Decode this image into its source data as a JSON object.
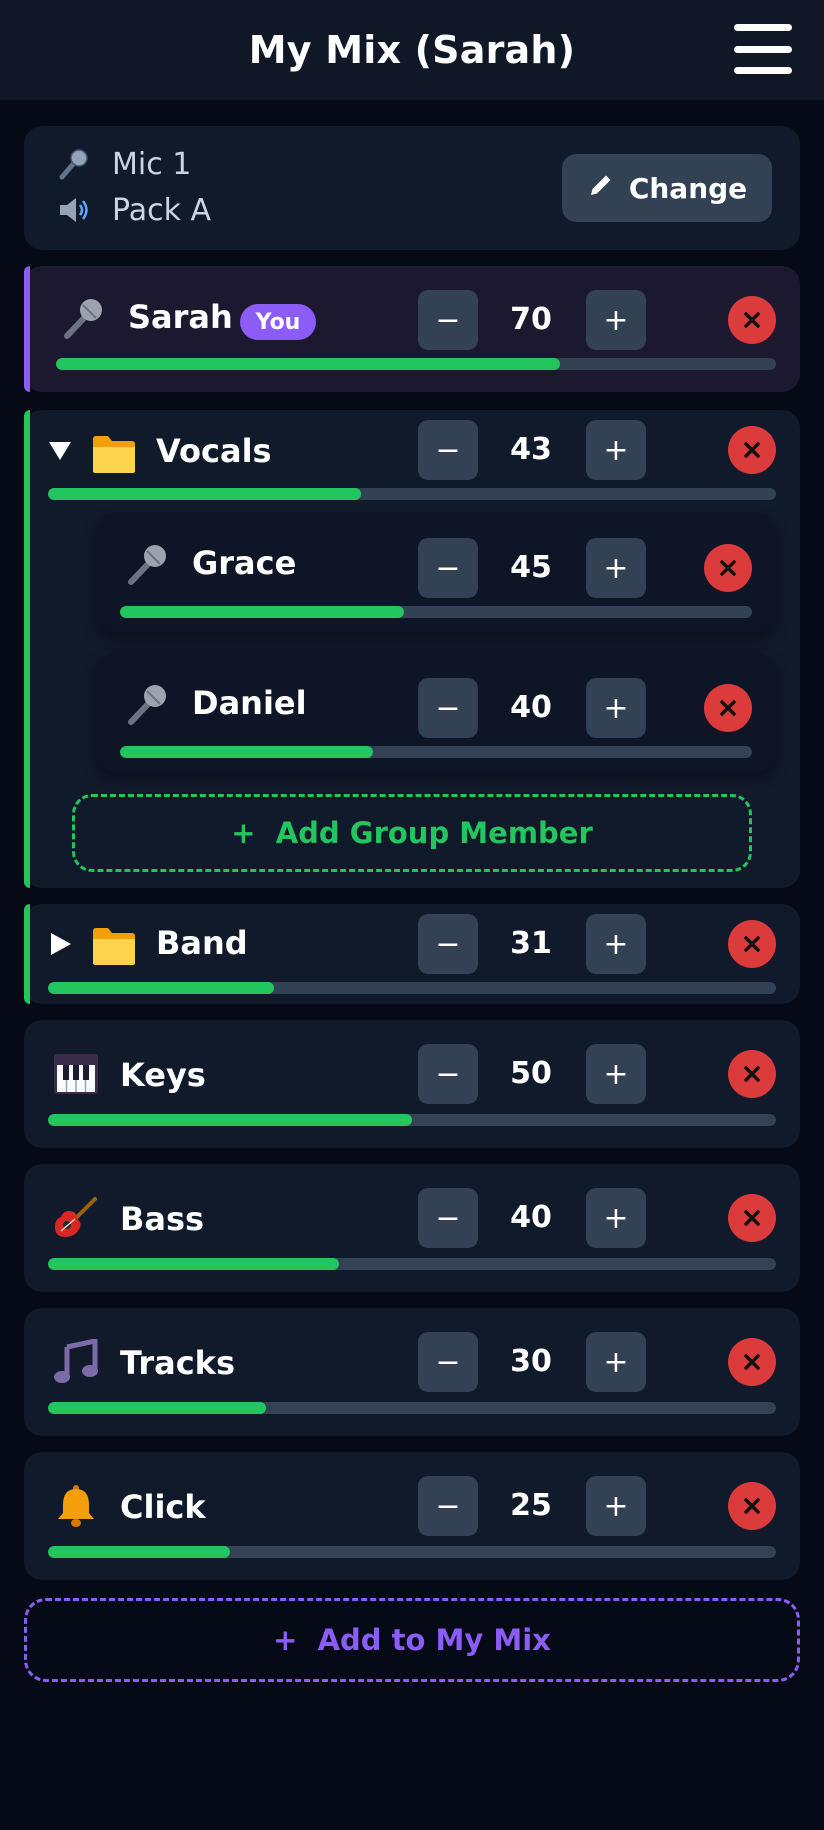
{
  "header": {
    "title": "My Mix (Sarah)"
  },
  "device": {
    "mic_label": "Mic 1",
    "pack_label": "Pack A",
    "change_label": "Change"
  },
  "channels": {
    "sarah": {
      "name": "Sarah",
      "badge": "You",
      "volume": 70,
      "icon": "microphone-icon",
      "accent": "#8b5cf6"
    },
    "vocals": {
      "name": "Vocals",
      "volume": 43,
      "icon": "folder-icon",
      "expanded": true,
      "accent": "#22c55e",
      "members": {
        "grace": {
          "name": "Grace",
          "volume": 45,
          "icon": "microphone-icon"
        },
        "daniel": {
          "name": "Daniel",
          "volume": 40,
          "icon": "microphone-icon"
        }
      },
      "add_member_label": "+  Add Group Member"
    },
    "band": {
      "name": "Band",
      "volume": 31,
      "icon": "folder-icon",
      "expanded": false,
      "accent": "#22c55e"
    },
    "keys": {
      "name": "Keys",
      "volume": 50,
      "icon": "piano-icon"
    },
    "bass": {
      "name": "Bass",
      "volume": 40,
      "icon": "guitar-icon"
    },
    "tracks": {
      "name": "Tracks",
      "volume": 30,
      "icon": "music-notes-icon"
    },
    "click": {
      "name": "Click",
      "volume": 25,
      "icon": "bell-icon"
    }
  },
  "controls": {
    "decrement": "−",
    "increment": "+"
  },
  "add_to_mix_label": "+  Add to My Mix",
  "colors": {
    "background": "#050a16",
    "card": "#111a2b",
    "stepper": "#334155",
    "level_fill": "#22c55e",
    "delete": "#dc3b3b",
    "accent_purple": "#8b5cf6"
  }
}
